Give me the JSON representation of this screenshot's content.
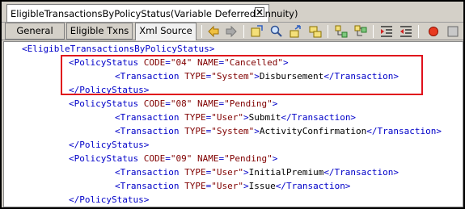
{
  "window": {
    "tab_title": "EligibleTransactionsByPolicyStatus(Variable Deferred Annuity)",
    "close_glyph": "⊠"
  },
  "view_tabs": [
    {
      "label": "General",
      "active": false
    },
    {
      "label": "Eligible Txns",
      "active": false
    },
    {
      "label": "Xml Source",
      "active": true
    }
  ],
  "toolbar_icons": [
    "nav-back-icon",
    "nav-forward-icon",
    "find-icon",
    "find-next-icon",
    "go-to-icon",
    "replace-icon",
    "expand-icon",
    "collapse-icon",
    "indent-icon",
    "outdent-icon",
    "stop-icon",
    "record-icon"
  ],
  "xml": {
    "root_open": "<EligibleTransactionsByPolicyStatus>",
    "groups": [
      {
        "code": "04",
        "name": "Cancelled",
        "transactions": [
          {
            "type": "System",
            "text": "Disbursement"
          }
        ]
      },
      {
        "code": "08",
        "name": "Pending",
        "transactions": [
          {
            "type": "User",
            "text": "Submit"
          },
          {
            "type": "System",
            "text": "ActivityConfirmation"
          }
        ]
      },
      {
        "code": "09",
        "name": "Pending",
        "transactions": [
          {
            "type": "User",
            "text": "InitialPremium"
          },
          {
            "type": "User",
            "text": "Issue"
          }
        ]
      }
    ]
  },
  "colors": {
    "tag": "#0000c8",
    "attr": "#800000",
    "highlight": "#e0101c"
  }
}
